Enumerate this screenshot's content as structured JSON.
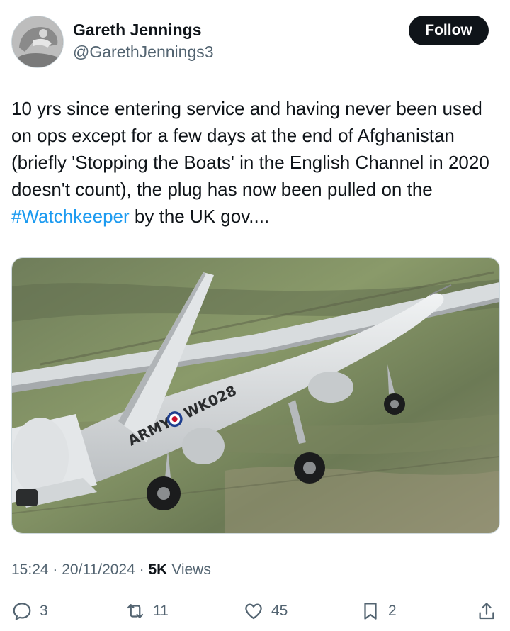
{
  "author": {
    "name": "Gareth Jennings",
    "handle": "@GarethJennings3",
    "avatar_icon": "helmet-avatar-icon"
  },
  "follow_label": "Follow",
  "tweet": {
    "text_before": "10 yrs since entering service and having never been used on ops except for a few days at the end of Afghanistan (briefly 'Stopping the Boats' in the English Channel in 2020 doesn't count), the plug has now been pulled on the ",
    "hashtag": "#Watchkeeper",
    "text_after": " by the UK gov...."
  },
  "media": {
    "fuselage_text_left": "ARMY",
    "fuselage_text_right": "WK028"
  },
  "meta": {
    "time": "15:24",
    "date": "20/11/2024",
    "separator": "·",
    "views_count": "5K",
    "views_label": "Views"
  },
  "actions": {
    "replies": "3",
    "reposts": "11",
    "likes": "45",
    "bookmarks": "2"
  },
  "colors": {
    "accent": "#1d9bf0",
    "text": "#0f1419",
    "muted": "#536471",
    "button_bg": "#0f1419"
  }
}
